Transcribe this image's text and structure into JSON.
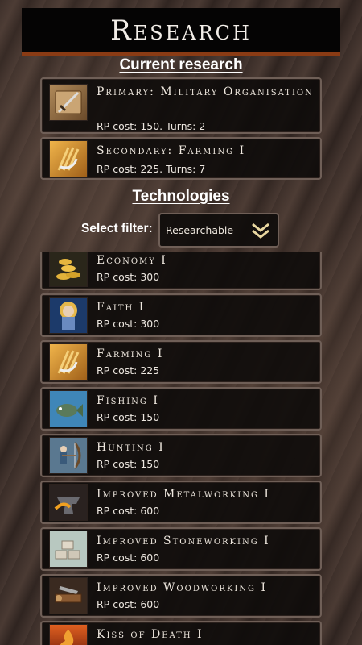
{
  "header": {
    "title": "Research",
    "close_icon": "close-icon"
  },
  "current_research": {
    "heading": "Current research",
    "items": [
      {
        "name": "Primary: Military Organisation",
        "cost": "RP cost: 150. Turns: 2",
        "icon": "sword-scroll-icon",
        "color": "#7a5a3a"
      },
      {
        "name": "Secondary: Farming I",
        "cost": "RP cost: 225. Turns: 7",
        "icon": "wheat-sickle-icon",
        "color": "#c9861e"
      }
    ]
  },
  "technologies": {
    "heading": "Technologies",
    "filter_label": "Select filter:",
    "filter_value": "Researchable",
    "items": [
      {
        "name": "Economy I",
        "cost": "RP cost: 300",
        "icon": "gold-coins-icon",
        "color": "#8a7a3a"
      },
      {
        "name": "Faith I",
        "cost": "RP cost: 300",
        "icon": "saint-icon",
        "color": "#2b4f8a"
      },
      {
        "name": "Farming I",
        "cost": "RP cost: 225",
        "icon": "wheat-sickle-icon",
        "color": "#c9861e"
      },
      {
        "name": "Fishing I",
        "cost": "RP cost: 150",
        "icon": "fish-icon",
        "color": "#3f86b8"
      },
      {
        "name": "Hunting I",
        "cost": "RP cost: 150",
        "icon": "archer-icon",
        "color": "#4d6f8a"
      },
      {
        "name": "Improved Metalworking I",
        "cost": "RP cost: 600",
        "icon": "anvil-icon",
        "color": "#5a4a40"
      },
      {
        "name": "Improved Stoneworking I",
        "cost": "RP cost: 600",
        "icon": "stone-blocks-icon",
        "color": "#9fb3a8"
      },
      {
        "name": "Improved Woodworking I",
        "cost": "RP cost: 600",
        "icon": "wood-saw-icon",
        "color": "#6b4a32"
      },
      {
        "name": "Kiss of Death I",
        "cost": "",
        "icon": "flame-icon",
        "color": "#b04a1a"
      }
    ]
  }
}
